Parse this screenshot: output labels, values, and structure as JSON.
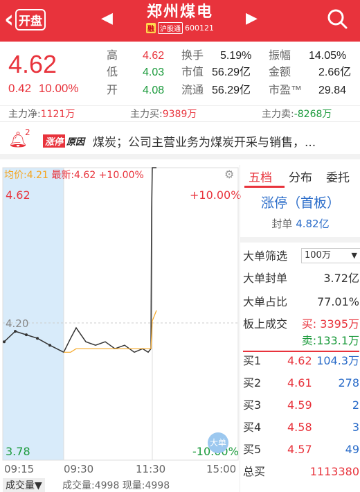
{
  "header": {
    "back_badge": "开盘",
    "stock_name": "郑州煤电",
    "tag_rong": "融",
    "tag_hgt": "沪股通",
    "code": "600121",
    "icons": {
      "back": "chevron-left-icon",
      "prev": "triangle-left-icon",
      "next": "triangle-right-icon",
      "search": "search-icon"
    }
  },
  "quote": {
    "price": "4.62",
    "change": "0.42",
    "change_pct": "10.00%",
    "high_label": "高",
    "high": "4.62",
    "low_label": "低",
    "low": "4.03",
    "open_label": "开",
    "open": "4.08",
    "turnover_label": "换手",
    "turnover": "5.19%",
    "mcap_label": "市值",
    "mcap": "56.29亿",
    "float_label": "流通",
    "float_cap": "56.29亿",
    "amp_label": "振幅",
    "amp": "14.05%",
    "amount_label": "金额",
    "amount": "2.66亿",
    "pe_label": "市盈™",
    "pe": "29.84"
  },
  "flow": {
    "net_label": "主力净:",
    "net": "1121万",
    "buy_label": "主力买:",
    "buy": "9389万",
    "sell_label": "主力卖:",
    "sell": "-8268万"
  },
  "notice": {
    "count": "2",
    "badge_red": "涨停",
    "badge_dark": "原因",
    "text": "煤炭；公司主营业务为煤炭开采与销售，..."
  },
  "chart": {
    "avg_label": "均价:4.21",
    "latest_label": "最新:4.62 +10.00%",
    "y_top": "4.62",
    "y_mid": "4.20",
    "y_bot": "3.78",
    "pct_top": "+10.00%",
    "pct_bot": "-10.00%",
    "x_labels": [
      "09:15",
      "09:30",
      "11:30",
      "15:00"
    ],
    "watermark": "大单",
    "colors": {
      "price": "#333333",
      "avg": "#f5a623",
      "pre_open_bg": "#d8ebfa"
    }
  },
  "chart_data": {
    "type": "line",
    "xlabel": "",
    "ylabel": "",
    "ylim": [
      3.78,
      4.62
    ],
    "x": [
      "09:15",
      "09:18",
      "09:21",
      "09:24",
      "09:27",
      "09:30",
      "09:35",
      "09:40",
      "09:50",
      "10:00",
      "10:15",
      "10:30",
      "10:45",
      "11:00",
      "11:15",
      "11:25",
      "11:30",
      "11:30b",
      "11:31",
      "11:32"
    ],
    "series": [
      {
        "values": [
          4.12,
          4.15,
          4.14,
          4.13,
          4.11,
          4.09,
          4.13,
          4.16,
          4.12,
          4.11,
          4.12,
          4.1,
          4.11,
          4.09,
          4.1,
          4.09,
          4.1,
          4.5,
          4.62,
          4.62
        ]
      },
      {
        "values": [
          null,
          null,
          null,
          null,
          null,
          4.09,
          4.09,
          4.1,
          4.1,
          4.1,
          4.1,
          4.1,
          4.1,
          4.1,
          4.1,
          4.1,
          4.1,
          4.14,
          4.18,
          4.21
        ]
      }
    ]
  },
  "side": {
    "tabs": [
      "五档",
      "分布",
      "委托"
    ],
    "limit_board": "涨停（首板）",
    "seal_label": "封单",
    "seal": "4.82亿",
    "filter_label": "大单筛选",
    "filter_value": "100万",
    "big_seal_label": "大单封单",
    "big_seal": "3.72亿",
    "big_ratio_label": "大单占比",
    "big_ratio": "77.01%",
    "board_label": "板上成交",
    "board_buy": "买: 3395万",
    "board_sell": "卖:133.1万",
    "bids": [
      {
        "label": "买1",
        "price": "4.62",
        "vol": "104.3万"
      },
      {
        "label": "买2",
        "price": "4.61",
        "vol": "278"
      },
      {
        "label": "买3",
        "price": "4.59",
        "vol": "2"
      },
      {
        "label": "买4",
        "price": "4.58",
        "vol": "3"
      },
      {
        "label": "买5",
        "price": "4.57",
        "vol": "49"
      }
    ],
    "total_label": "总买",
    "total": "1113380"
  },
  "bottom": {
    "vol_btn": "成交量▼",
    "vol_text": "成交量:4998 现量:4998"
  }
}
